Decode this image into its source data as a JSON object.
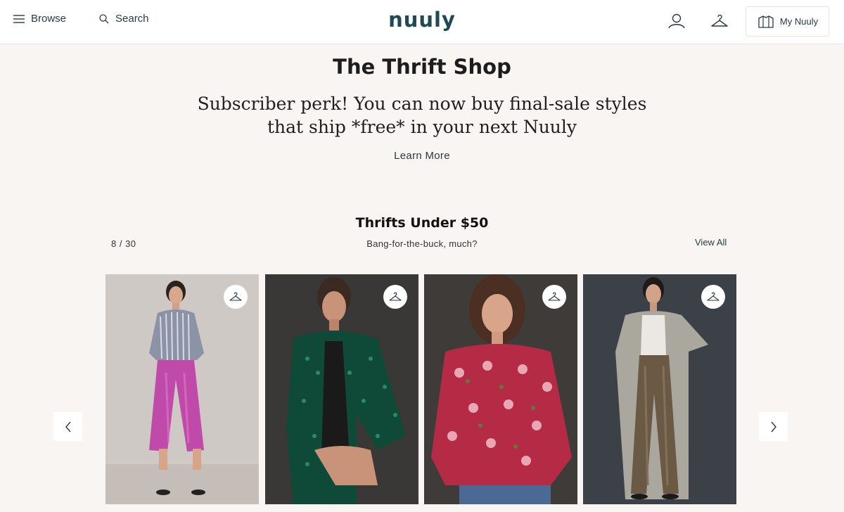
{
  "header": {
    "browse_label": "Browse",
    "search_label": "Search",
    "logo": "nuuly",
    "my_nuuly_label": "My Nuuly"
  },
  "hero": {
    "title": "The Thrift Shop",
    "line1": "Subscriber perk! You can now buy final-sale styles",
    "line2": "that ship *free* in your next Nuuly",
    "learn_more": "Learn More"
  },
  "section": {
    "title": "Thrifts Under $50",
    "counter": "8 / 30",
    "subtitle": "Bang-for-the-buck, much?",
    "view_all": "View All"
  },
  "colors": {
    "background": "#f8f5f2",
    "logo": "#1e4a55",
    "text": "#1f2c33"
  },
  "icons": {
    "browse": "hamburger-icon",
    "search": "search-icon",
    "account": "user-icon",
    "closet": "hanger-icon",
    "my_nuuly": "box-icon",
    "card_action": "hanger-icon",
    "carousel_prev": "chevron-left-icon",
    "carousel_next": "chevron-right-icon"
  }
}
